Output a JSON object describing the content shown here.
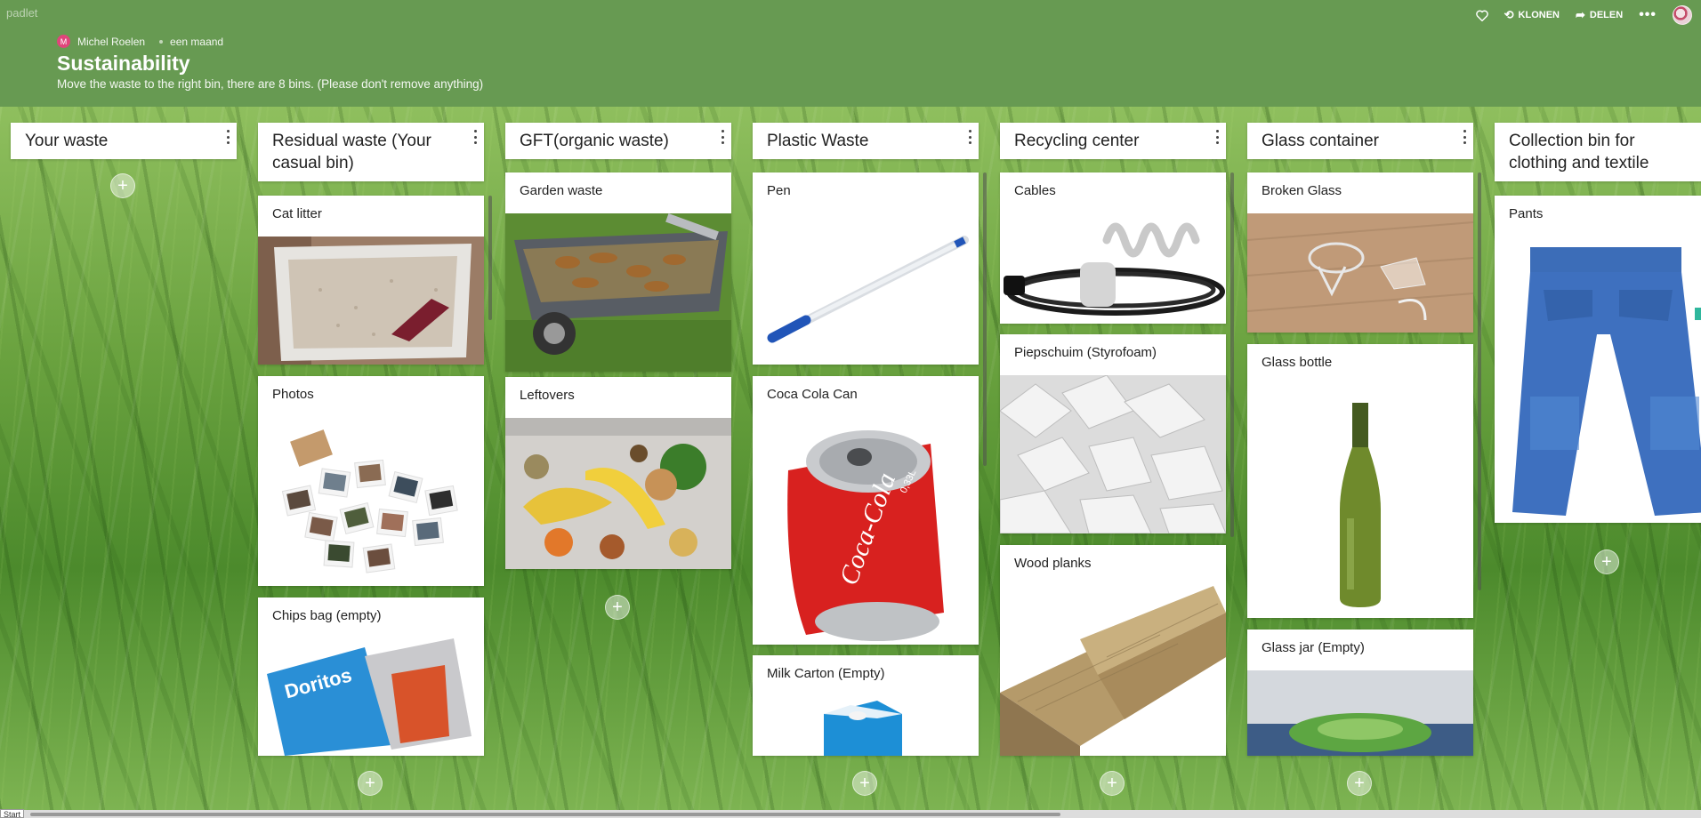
{
  "app": {
    "logo": "padlet"
  },
  "header": {
    "author_initial": "M",
    "author_name": "Michel Roelen",
    "time_ago": "een maand",
    "title": "Sustainability",
    "subtitle": "Move the waste to the right bin, there are 8 bins. (Please don't remove anything)"
  },
  "actions": {
    "like_icon": "heart-icon",
    "clone_label": "KLONEN",
    "share_label": "DELEN",
    "more_icon": "more-icon"
  },
  "columns": [
    {
      "title": "Your waste",
      "cards": []
    },
    {
      "title": "Residual waste (Your casual bin)",
      "cards": [
        {
          "title": "Cat litter"
        },
        {
          "title": "Photos"
        },
        {
          "title": "Chips bag (empty)"
        }
      ]
    },
    {
      "title": "GFT(organic waste)",
      "cards": [
        {
          "title": "Garden waste"
        },
        {
          "title": "Leftovers"
        }
      ]
    },
    {
      "title": "Plastic Waste",
      "cards": [
        {
          "title": "Pen"
        },
        {
          "title": "Coca Cola Can"
        },
        {
          "title": "Milk Carton (Empty)"
        }
      ]
    },
    {
      "title": "Recycling center",
      "cards": [
        {
          "title": "Cables"
        },
        {
          "title": "Piepschuim (Styrofoam)"
        },
        {
          "title": "Wood planks"
        }
      ]
    },
    {
      "title": "Glass container",
      "cards": [
        {
          "title": "Broken Glass"
        },
        {
          "title": "Glass bottle"
        },
        {
          "title": "Glass jar (Empty)"
        }
      ]
    },
    {
      "title": "Collection bin for clothing and textile",
      "cards": [
        {
          "title": "Pants"
        }
      ]
    }
  ],
  "image_texts": {
    "can_text": "Coca-Cola",
    "can_size": "0,33L",
    "chips_brand": "Doritos"
  },
  "taskbar": {
    "start_label": "Start"
  }
}
